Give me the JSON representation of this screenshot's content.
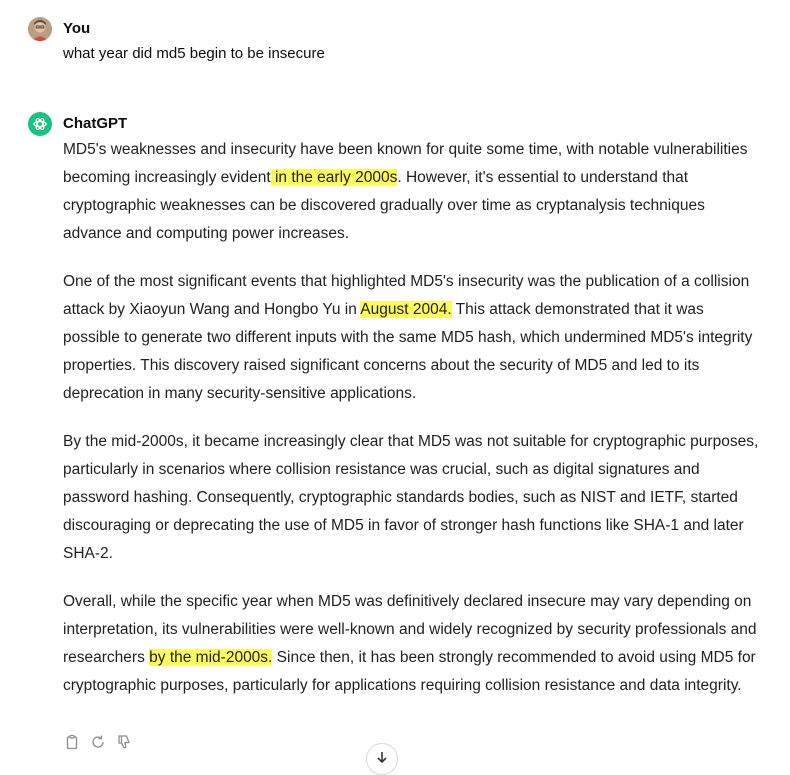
{
  "user": {
    "name": "You",
    "message": "what year did md5 begin to be insecure"
  },
  "assistant": {
    "name": "ChatGPT",
    "p1": {
      "a": "MD5's weaknesses and insecurity have been known for quite some time, with notable vulnerabilities becoming increasingly evident",
      "hl": " in the early 2000s",
      "b": ". However, it's essential to understand that cryptographic weaknesses can be discovered gradually over time as cryptanalysis techniques advance and computing power increases."
    },
    "p2": {
      "a": "One of the most significant events that highlighted MD5's insecurity was the publication of a collision attack by Xiaoyun Wang and Hongbo Yu in ",
      "hl": "August 2004.",
      "b": " This attack demonstrated that it was possible to generate two different inputs with the same MD5 hash, which undermined MD5's integrity properties. This discovery raised significant concerns about the security of MD5 and led to its deprecation in many security-sensitive applications."
    },
    "p3": "By the mid-2000s, it became increasingly clear that MD5 was not suitable for cryptographic purposes, particularly in scenarios where collision resistance was crucial, such as digital signatures and password hashing. Consequently, cryptographic standards bodies, such as NIST and IETF, started discouraging or deprecating the use of MD5 in favor of stronger hash functions like SHA-1 and later SHA-2.",
    "p4": {
      "a": "Overall, while the specific year when MD5 was definitively declared insecure may vary depending on interpretation, its vulnerabilities were well-known and widely recognized by security professionals and researchers ",
      "hl": "by the mid-2000s.",
      "b": " Since then, it has been strongly recommended to avoid using MD5 for cryptographic purposes, particularly for applications requiring collision resistance and data integrity."
    }
  },
  "actions": {
    "icons": [
      "clipboard-icon",
      "regenerate-icon",
      "thumbs-down-icon"
    ]
  },
  "colors": {
    "highlight": "#fdfc5a",
    "brand": "#19c37d"
  }
}
